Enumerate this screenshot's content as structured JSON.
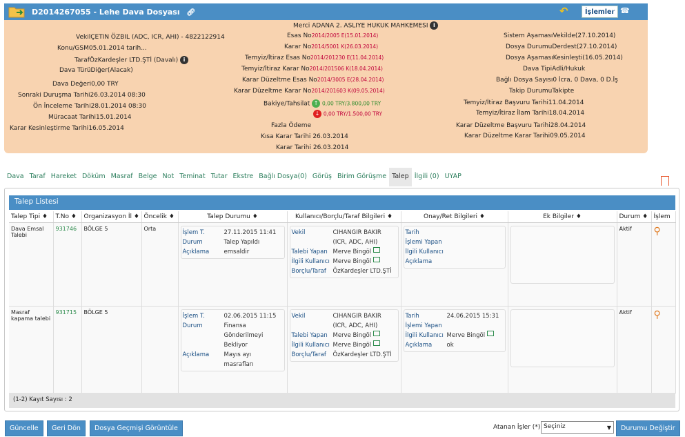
{
  "header": {
    "title": "D2014267055 - Lehe Dava Dosyası",
    "islemler_label": "İşlemler"
  },
  "info": {
    "mahkeme_label": "Merci",
    "mahkeme_value": "ADANA 2. ASLIYE HUKUK MAHKEMESI",
    "left": [
      {
        "label": "Vekil",
        "value": "ÇETIN ÖZBIL (ADC, ICR, AHI) - 4822122914"
      },
      {
        "label": "Konu/GSM",
        "value": "05.01.2014 tarih..."
      },
      {
        "label": "Taraf",
        "value": "ÖzKardeşler LTD.ŞTİ  (Davalı)"
      },
      {
        "label": "Dava Türü",
        "value": "Diğer(Alacak)"
      },
      {
        "label": "Dava Değeri",
        "value": "0,00 TRY"
      },
      {
        "label": "Sonraki Duruşma Tarihi",
        "value": "26.03.2014 08:30"
      },
      {
        "label": "Ön İnceleme Tarihi",
        "value": "28.01.2014 08:30"
      },
      {
        "label": "Müracaat Tarihi",
        "value": "15.01.2014"
      },
      {
        "label": "Karar Kesinleştirme Tarihi",
        "value": "16.05.2014"
      }
    ],
    "middle": [
      {
        "label": "Esas No",
        "value": "2014/2005 E(15.01.2014)"
      },
      {
        "label": "Karar No",
        "value": "2014/5001 K(26.03.2014)"
      },
      {
        "label": "Temyiz/İtiraz Esas No",
        "value": "2014/201230 E(11.04.2014)"
      },
      {
        "label": "Temyiz/İtiraz Karar No",
        "value": "2014/201506 K(18.04.2014)"
      },
      {
        "label": "Karar Düzeltme Esas No",
        "value": "2014/3005 E(28.04.2014)"
      },
      {
        "label": "Karar Düzeltme Karar No",
        "value": "2014/201603 K(09.05.2014)"
      }
    ],
    "bakiye_label": "Bakiye/Tahsilat",
    "bakiye_up": "0,00 TRY/3.800,00 TRY",
    "bakiye_down": "0,00 TRY/1.500,00 TRY",
    "fazla_odeme_label": "Fazla Ödeme",
    "kisa_karar_label": "Kısa Karar Tarihi",
    "kisa_karar_value": "26.03.2014",
    "karar_tarihi_label": "Karar Tarihi",
    "karar_tarihi_value": "26.03.2014",
    "right": [
      {
        "label": "Sistem Aşaması",
        "value": "Vekilde(27.10.2014)"
      },
      {
        "label": "Dosya Durumu",
        "value": "Derdest(27.10.2014)"
      },
      {
        "label": "Dosya Aşaması",
        "value": "Kesinleşti(16.05.2014)"
      },
      {
        "label": "Dava Tipi",
        "value": "Adli/Hukuk"
      },
      {
        "label": "Bağlı Dosya Sayısı",
        "value": "0 İcra, 0 Dava, 0 D.İş"
      },
      {
        "label": "Takip Durumu",
        "value": "Takipte"
      },
      {
        "label": "Temyiz/İtiraz Başvuru Tarihi",
        "value": "11.04.2014"
      },
      {
        "label": "Temyiz/İtiraz İlam Tarihi",
        "value": "18.04.2014"
      },
      {
        "label": "Karar Düzeltme Başvuru Tarihi",
        "value": "28.04.2014"
      },
      {
        "label": "Karar Düzeltme Karar Tarihi",
        "value": "09.05.2014"
      }
    ]
  },
  "tabs": [
    "Dava",
    "Taraf",
    "Hareket",
    "Döküm",
    "Masraf",
    "Belge",
    "Not",
    "Teminat",
    "Tutar",
    "Ekstre",
    "Bağlı Dosya(0)",
    "Görüş",
    "Birim Görüşme",
    "Talep",
    "İlgili (0)",
    "UYAP"
  ],
  "active_tab": "Talep",
  "panel_title": "Talep Listesi",
  "columns": [
    "Talep Tipi",
    "T.No",
    "Organizasyon İl",
    "Öncelik",
    "Talep Durumu",
    "Kullanıcı/Borçlu/Taraf Bilgileri",
    "Onay/Ret Bilgileri",
    "Ek Bilgiler",
    "Durum",
    "İşlem"
  ],
  "rows": [
    {
      "talep_tipi": "Dava Emsal Talebi",
      "tno": "931746",
      "org": "BÖLGE 5",
      "oncelik": "Orta",
      "durum_box": [
        {
          "k": "İşlem T.",
          "v": "27.11.2015 11:41"
        },
        {
          "k": "Durum",
          "v": "Talep Yapıldı"
        },
        {
          "k": "Açıklama",
          "v": "emsaldir"
        }
      ],
      "kullanici": [
        {
          "k": "Vekil",
          "v": "CIHANGIR BAKIR (ICR, ADC, AHI)"
        },
        {
          "k": "Talebi Yapan",
          "v": "Merve Bingöl"
        },
        {
          "k": "İlgili Kullanıcı",
          "v": "Merve Bingöl"
        },
        {
          "k": "Borçlu/Taraf",
          "v": "ÖzKardeşler LTD.ŞTİ"
        }
      ],
      "onay": [
        {
          "k": "Tarih",
          "v": ""
        },
        {
          "k": "İşlemi Yapan",
          "v": ""
        },
        {
          "k": "İlgili Kullanıcı",
          "v": ""
        },
        {
          "k": "Açıklama",
          "v": ""
        }
      ],
      "durum": "Aktif"
    },
    {
      "talep_tipi": "Masraf kapama talebi",
      "tno": "931715",
      "org": "BÖLGE 5",
      "oncelik": "",
      "durum_box": [
        {
          "k": "İşlem T.",
          "v": "02.06.2015 11:15"
        },
        {
          "k": "Durum",
          "v": "Finansa Gönderilmeyi Bekliyor"
        },
        {
          "k": "Açıklama",
          "v": "Mayıs ayı masrafları"
        }
      ],
      "kullanici": [
        {
          "k": "Vekil",
          "v": "CIHANGIR BAKIR (ICR, ADC, AHI)"
        },
        {
          "k": "Talebi Yapan",
          "v": "Merve Bingöl"
        },
        {
          "k": "İlgili Kullanıcı",
          "v": "Merve Bingöl"
        },
        {
          "k": "Borçlu/Taraf",
          "v": "ÖzKardeşler LTD.ŞTİ"
        }
      ],
      "onay": [
        {
          "k": "Tarih",
          "v": "24.06.2015 15:31"
        },
        {
          "k": "İşlemi Yapan",
          "v": ""
        },
        {
          "k": "İlgili Kullanıcı",
          "v": "Merve Bingöl"
        },
        {
          "k": "Açıklama",
          "v": "ok"
        }
      ],
      "durum": "Aktif"
    }
  ],
  "record_count": "(1-2) Kayıt Sayısı : 2",
  "buttons": {
    "guncelle": "Güncelle",
    "geri_don": "Geri Dön",
    "gecmis": "Dosya Geçmişi Görüntüle",
    "durum_degistir": "Durumu Değiştir"
  },
  "atanan_label": "Atanan İşler (*)",
  "atanan_selected": "Seçiniz",
  "colors": {
    "header_blue": "#4a8ec5",
    "info_bg": "#f8d3b0",
    "link_green": "#2a8a4a",
    "red_value": "#c0003a"
  },
  "icons": [
    "folder-icon",
    "link-icon",
    "back-arrow-icon",
    "edit-icon",
    "phone-icon",
    "info-icon",
    "arrow-up-icon",
    "arrow-down-icon",
    "bookmark-icon",
    "mail-icon",
    "search-icon"
  ]
}
